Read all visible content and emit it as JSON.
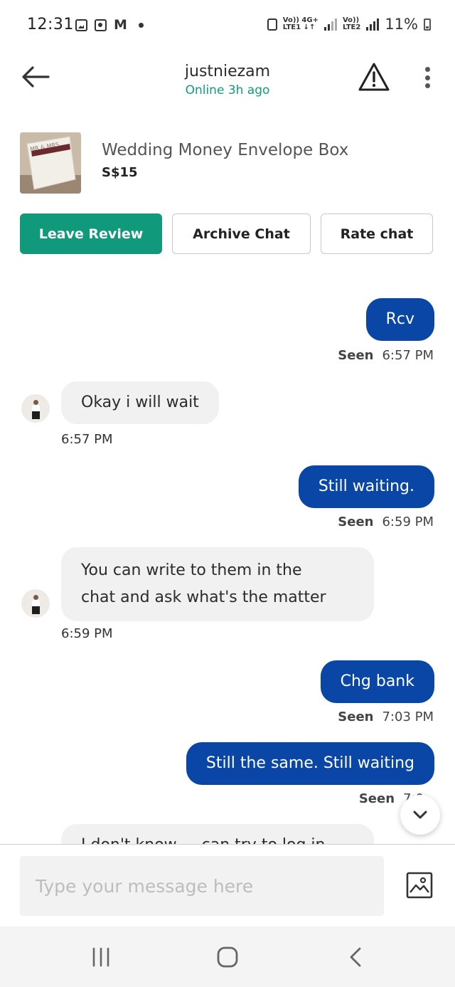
{
  "status_bar": {
    "time": "12:31",
    "mail_glyph": "M",
    "net1_top": "Vo)) 4G+",
    "net1_bottom": "LTE1 ↓↑",
    "net2_top": "Vo))",
    "net2_bottom": "LTE2",
    "battery": "11%"
  },
  "header": {
    "title": "justniezam",
    "subtitle": "Online 3h ago",
    "icons": [
      "arrow-left-icon",
      "warning-icon",
      "more-vertical-icon"
    ]
  },
  "listing": {
    "title": "Wedding Money Envelope Box",
    "price": "S$15",
    "thumb_text": "MR & MRS"
  },
  "actions": {
    "leave_review": "Leave Review",
    "archive_chat": "Archive Chat",
    "rate_chat": "Rate chat"
  },
  "messages": [
    {
      "dir": "out",
      "text": "Rcv",
      "status": "Seen",
      "time": "6:57 PM"
    },
    {
      "dir": "in",
      "text": "Okay i will wait",
      "time": "6:57 PM"
    },
    {
      "dir": "out",
      "text": "Still waiting.",
      "status": "Seen",
      "time": "6:59 PM"
    },
    {
      "dir": "in",
      "line1": "You can write to them in the",
      "line2": "chat and ask what's the matter",
      "time": "6:59 PM"
    },
    {
      "dir": "out",
      "text": "Chg bank",
      "status": "Seen",
      "time": "7:03 PM"
    },
    {
      "dir": "out",
      "text": "Still the same. Still waiting",
      "status": "Seen",
      "time": "7:0"
    },
    {
      "dir": "in",
      "text": "I don't know ... can try to log in"
    }
  ],
  "composer": {
    "placeholder": "Type your message here"
  },
  "colors": {
    "accent_green": "#11997c",
    "online_green": "#0f9d7a",
    "outgoing_bubble": "#0a46a5",
    "incoming_bubble": "#f1f1f1"
  }
}
